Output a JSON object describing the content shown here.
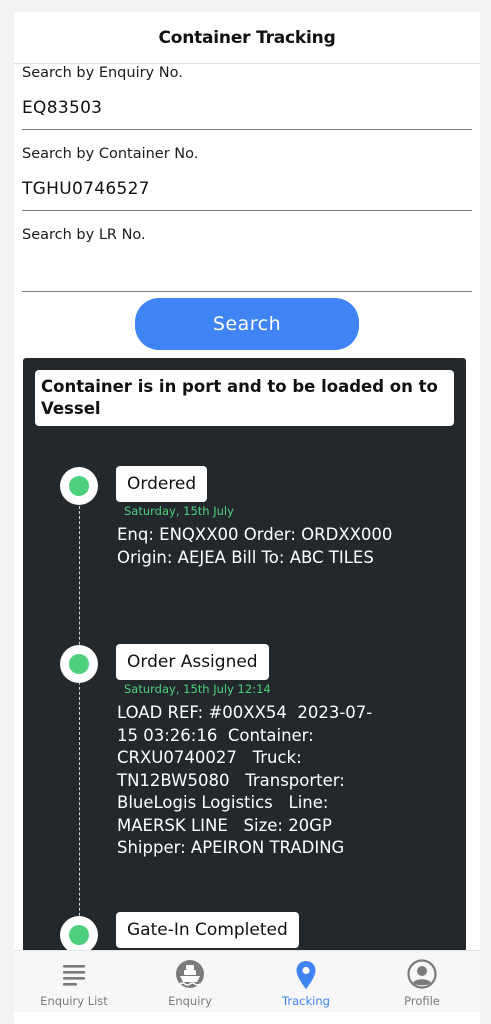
{
  "header": {
    "title": "Container Tracking"
  },
  "search": {
    "enquiry": {
      "label": "Search by Enquiry No.",
      "value": "EQ83503"
    },
    "container": {
      "label": "Search by Container No.",
      "value": "TGHU0746527"
    },
    "lr": {
      "label": "Search by LR No.",
      "value": ""
    },
    "button_label": "Search"
  },
  "tracking": {
    "status": "Container is in port and to be loaded on to Vessel",
    "events": [
      {
        "title": "Ordered",
        "date": "Saturday, 15th July",
        "details": "Enq: ENQXX00 Order: ORDXX000   Origin: AEJEA Bill To: ABC TILES"
      },
      {
        "title": "Order Assigned",
        "date": "Saturday, 15th July 12:14",
        "details": "LOAD REF: #00XX54  2023-07-15 03:26:16  Container: CRXU0740027   Truck: TN12BW5080   Transporter: BlueLogis Logistics   Line: MAERSK LINE   Size: 20GP Shipper: APEIRON TRADING"
      },
      {
        "title": "Gate-In Completed"
      }
    ]
  },
  "tabbar": {
    "items": [
      {
        "label": "Enquiry List",
        "icon": "list-icon"
      },
      {
        "label": "Enquiry",
        "icon": "ship-icon"
      },
      {
        "label": "Tracking",
        "icon": "location-pin-icon"
      },
      {
        "label": "Profile",
        "icon": "user-icon"
      }
    ],
    "active": "Tracking"
  },
  "colors": {
    "accent": "#3f83f5",
    "panel_bg": "#23282c",
    "status_green": "#4cd07d"
  }
}
